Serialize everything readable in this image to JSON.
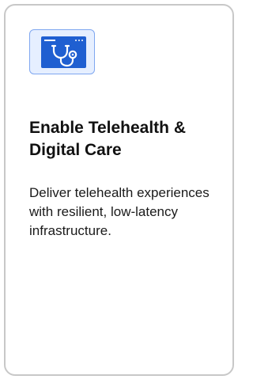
{
  "card": {
    "icon": "telehealth-stethoscope-monitor-icon",
    "title": "Enable Telehealth & Digital Care",
    "description": "Deliver telehealth experiences with resilient, low-latency infrastructure."
  },
  "colors": {
    "icon_tile_bg": "#e6efff",
    "icon_tile_border": "#7fa7f0",
    "icon_blue": "#1f5fd1",
    "card_border": "#c8c8c8",
    "title_text": "#111111"
  }
}
